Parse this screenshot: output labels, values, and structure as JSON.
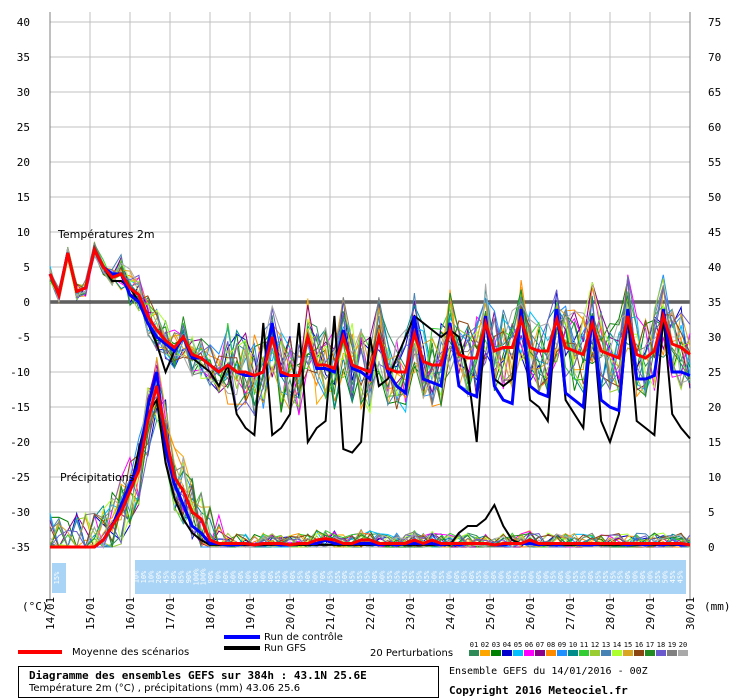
{
  "chart_data": {
    "type": "line",
    "left_axis_unit": "(°C)",
    "right_axis_unit": "(mm)",
    "left_ticks": [
      40,
      35,
      30,
      25,
      20,
      15,
      10,
      5,
      0,
      -5,
      -10,
      -15,
      -20,
      -25,
      -30,
      -35
    ],
    "right_ticks": [
      75,
      70,
      65,
      60,
      55,
      50,
      45,
      40,
      35,
      30,
      25,
      20,
      15,
      10,
      5,
      0
    ],
    "ylim_temp": [
      -35,
      40
    ],
    "ylim_precip": [
      0,
      75
    ],
    "x_dates": [
      "14/01",
      "15/01",
      "16/01",
      "17/01",
      "18/01",
      "19/01",
      "20/01",
      "21/01",
      "22/01",
      "23/01",
      "24/01",
      "25/01",
      "26/01",
      "27/01",
      "28/01",
      "29/01",
      "30/01"
    ],
    "temp_label": "Températures 2m",
    "precip_label": "Précipitations",
    "snow_left": "15%",
    "snow_labels": [
      "10%",
      "10%",
      "10%",
      "20%",
      "45%",
      "50%",
      "85%",
      "90%",
      "100%",
      "100%",
      "90%",
      "70%",
      "60%",
      "60%",
      "50%",
      "50%",
      "40%",
      "40%",
      "40%",
      "45%",
      "50%",
      "40%",
      "45%",
      "40%",
      "60%",
      "70%",
      "65%",
      "65%",
      "50%",
      "45%",
      "45%",
      "45%",
      "40%",
      "60%",
      "45%",
      "55%",
      "45%",
      "45%",
      "45%",
      "45%",
      "50%",
      "55%",
      "70%",
      "60%",
      "45%",
      "40%",
      "45%",
      "50%",
      "50%",
      "50%",
      "50%",
      "45%",
      "45%",
      "60%",
      "60%",
      "50%",
      "45%",
      "60%",
      "60%",
      "45%",
      "45%",
      "50%",
      "45%",
      "45%",
      "45%",
      "45%",
      "50%",
      "30%",
      "50%",
      "30%",
      "55%",
      "50%",
      "45%",
      "45%"
    ],
    "series": [
      {
        "name": "Moyenne des scénarios",
        "color": "#ff0000",
        "temp": [
          4,
          1,
          7,
          1.5,
          2,
          7.5,
          5,
          3.5,
          4,
          2,
          1,
          -2,
          -4,
          -5.5,
          -6.5,
          -5,
          -7.5,
          -8,
          -9,
          -10,
          -9,
          -10,
          -10,
          -10.5,
          -10,
          -5,
          -10,
          -10.5,
          -10.5,
          -5,
          -9,
          -9,
          -9.5,
          -5,
          -9,
          -9.5,
          -10,
          -5,
          -9.5,
          -10,
          -10,
          -4.5,
          -8.5,
          -9,
          -9,
          -4,
          -7.5,
          -8,
          -8,
          -3,
          -7,
          -6.5,
          -6.5,
          -2.5,
          -6.5,
          -7,
          -7,
          -2.5,
          -6.5,
          -7,
          -7.5,
          -3,
          -7,
          -7.5,
          -8,
          -2,
          -7.5,
          -8,
          -7,
          -2,
          -6,
          -6.5,
          -7.5
        ],
        "precip": [
          0,
          0,
          0,
          0,
          0,
          0,
          1,
          3,
          5,
          8,
          11,
          18,
          23,
          16,
          10,
          8,
          5,
          4,
          1,
          0.5,
          0.5,
          0.5,
          0.5,
          0.3,
          0.5,
          0.5,
          0.5,
          0.3,
          0.5,
          0.5,
          1,
          1.2,
          1,
          0.5,
          0.5,
          1,
          1,
          0.5,
          0.5,
          0.5,
          0.5,
          1,
          0.5,
          1,
          0.5,
          0.5,
          0.5,
          0.5,
          0.5,
          0.5,
          0.3,
          0.5,
          0.5,
          0.5,
          1,
          0.5,
          0.5,
          0.5,
          0.5,
          0.5,
          0.5,
          0.5,
          0.5,
          0.5,
          0.5,
          0.5,
          0.5,
          0.5,
          0.5,
          0.5,
          0.5,
          0.5,
          0.3
        ]
      },
      {
        "name": "Run de contrôle",
        "color": "#0000ff",
        "temp": [
          4,
          1,
          7,
          1.5,
          2,
          7.5,
          5,
          4,
          4,
          1,
          0,
          -3,
          -5,
          -6,
          -7,
          -5,
          -8,
          -8,
          -9,
          -10,
          -9,
          -10,
          -10.5,
          -10.5,
          -10,
          -3,
          -10.5,
          -10.5,
          -10.5,
          -5,
          -9.5,
          -9.5,
          -10,
          -4,
          -9.5,
          -10,
          -11,
          -5,
          -10,
          -12,
          -13,
          -2,
          -11,
          -11.5,
          -12,
          -3,
          -12,
          -13,
          -13.5,
          -2,
          -12,
          -14,
          -14.5,
          -1,
          -12,
          -13,
          -13.5,
          -1,
          -13,
          -14,
          -15,
          -2,
          -14,
          -15,
          -15.5,
          -1,
          -11,
          -11,
          -10.5,
          -1,
          -10,
          -10,
          -10.5
        ],
        "precip": [
          0,
          0,
          0,
          0,
          0,
          0,
          1,
          3,
          6,
          9,
          12,
          20,
          25,
          14,
          9,
          6,
          3,
          2,
          0.5,
          0.5,
          0.3,
          0.3,
          0.5,
          0.3,
          0.5,
          0.5,
          0.3,
          0.3,
          0.5,
          0.5,
          0.5,
          1,
          0.5,
          0.5,
          0.5,
          0.5,
          0.5,
          0.3,
          0.5,
          0.3,
          0.5,
          0.5,
          0.5,
          0.5,
          0.3,
          0.5,
          0.3,
          0.5,
          0.5,
          0.5,
          0.3,
          0.3,
          0.5,
          0.5,
          0.5,
          0.3,
          0.5,
          0.3,
          0.5,
          0.5,
          0.3,
          0.3,
          0.5,
          0.5,
          0.5,
          0.3,
          0.5,
          0.3,
          0.5,
          0.3,
          0.5,
          0.3,
          0.3
        ]
      },
      {
        "name": "Run GFS",
        "color": "#000000",
        "temp": [
          4,
          1,
          7,
          1.5,
          2,
          7.5,
          5,
          3,
          3,
          2,
          0,
          -3,
          -6,
          -10,
          -7,
          -5,
          -8,
          -9,
          -10,
          -12,
          -9,
          -16,
          -18,
          -19,
          -3,
          -19,
          -18,
          -16,
          -3,
          -20,
          -18,
          -17,
          -2,
          -21,
          -21.5,
          -20,
          -5,
          -12,
          -11,
          -8,
          -5,
          -2,
          -3,
          -4,
          -5,
          -4,
          -5,
          -10,
          -20,
          -2,
          -11,
          -12,
          -11,
          -1,
          -14,
          -15,
          -17,
          -1,
          -14,
          -16,
          -18,
          -2,
          -17,
          -20,
          -16,
          -2,
          -17,
          -18,
          -19,
          -2,
          -16,
          -18,
          -19.5
        ],
        "precip": [
          0,
          0,
          0,
          0,
          0,
          0,
          1,
          3,
          5,
          8,
          14,
          19,
          21,
          12,
          7,
          4,
          2,
          1,
          0.3,
          0.3,
          0.3,
          0.3,
          0.3,
          0.3,
          0.3,
          0.3,
          0.3,
          0.3,
          0.3,
          0.3,
          0.3,
          0.3,
          0.3,
          0.3,
          0.3,
          0.3,
          0.3,
          0.3,
          0.3,
          0.3,
          0.3,
          0.3,
          0.3,
          0.3,
          0.3,
          0.3,
          2,
          3,
          3,
          4,
          6,
          3,
          1,
          0.5,
          0.5,
          0.3,
          0.3,
          0.3,
          0.3,
          0.3,
          0.3,
          0.3,
          0.3,
          0.3,
          0.3,
          0.3,
          0.3,
          0.3,
          0.3,
          0.3,
          0.3,
          0.3,
          0.3
        ]
      }
    ],
    "perturbation_colors": [
      "#2e8b57",
      "#ffa500",
      "#008000",
      "#0000cd",
      "#00bfff",
      "#ff00ff",
      "#8b008b",
      "#ff8c00",
      "#1e90ff",
      "#008b8b",
      "#32cd32",
      "#9acd32",
      "#4682b4",
      "#adff2f",
      "#daa520",
      "#8b4513",
      "#228b22",
      "#6a5acd",
      "#808080",
      "#a9a9a9"
    ],
    "perturbation_numbers": [
      "01",
      "02",
      "03",
      "04",
      "05",
      "06",
      "07",
      "08",
      "09",
      "10",
      "11",
      "12",
      "13",
      "14",
      "15",
      "16",
      "17",
      "18",
      "19",
      "20"
    ],
    "legend": {
      "mean": "Moyenne des scénarios",
      "control": "Run de contrôle",
      "gfs": "Run GFS",
      "perturbations": "20 Perturbations"
    }
  },
  "footer": {
    "title": "Diagramme des ensembles GEFS sur 384h : 43.1N 25.6E",
    "subtitle": "Température 2m (°C) , précipitations (mm) 43.06 25.6",
    "ensemble": "Ensemble GEFS du 14/01/2016 - 00Z",
    "copyright": "Copyright 2016 Meteociel.fr"
  }
}
